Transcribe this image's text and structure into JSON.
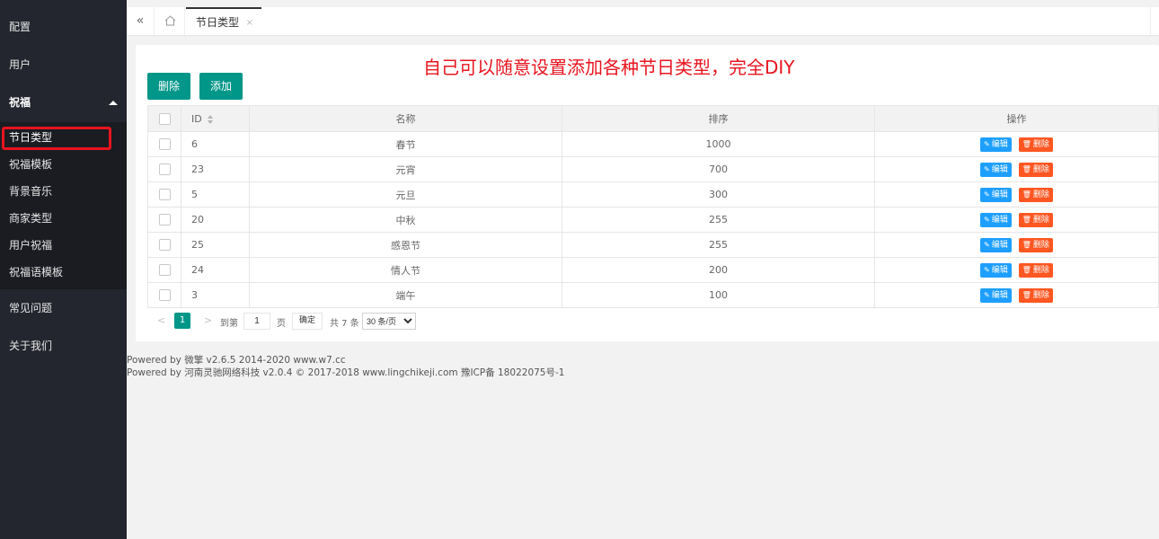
{
  "sidebar": {
    "items": [
      {
        "label": "配置"
      },
      {
        "label": "用户"
      },
      {
        "label": "祝福"
      },
      {
        "label": "常见问题"
      },
      {
        "label": "关于我们"
      }
    ],
    "subitems": [
      {
        "label": "节日类型"
      },
      {
        "label": "祝福模板"
      },
      {
        "label": "背景音乐"
      },
      {
        "label": "商家类型"
      },
      {
        "label": "用户祝福"
      },
      {
        "label": "祝福语模板"
      }
    ]
  },
  "tabs": {
    "collapse_icon": "«",
    "active_label": "节日类型",
    "close_icon": "×"
  },
  "annotation": "自己可以随意设置添加各种节日类型，完全DIY",
  "toolbar": {
    "delete_label": "删除",
    "add_label": "添加"
  },
  "table": {
    "headers": {
      "id": "ID",
      "name": "名称",
      "sort": "排序",
      "ops": "操作"
    },
    "edit_label": "编辑",
    "delete_label": "删除",
    "rows": [
      {
        "id": "6",
        "name": "春节",
        "sort": "1000"
      },
      {
        "id": "23",
        "name": "元宵",
        "sort": "700"
      },
      {
        "id": "5",
        "name": "元旦",
        "sort": "300"
      },
      {
        "id": "20",
        "name": "中秋",
        "sort": "255"
      },
      {
        "id": "25",
        "name": "感恩节",
        "sort": "255"
      },
      {
        "id": "24",
        "name": "情人节",
        "sort": "200"
      },
      {
        "id": "3",
        "name": "端午",
        "sort": "100"
      }
    ]
  },
  "pager": {
    "prev": "<",
    "current": "1",
    "next": ">",
    "goto_label": "到第",
    "page_value": "1",
    "page_unit": "页",
    "confirm": "确定",
    "total": "共 7 条",
    "page_size": "30 条/页"
  },
  "footer": {
    "line1": "Powered by 微擎 v2.6.5 2014-2020 www.w7.cc",
    "line2": "Powered by 河南灵驰网络科技 v2.0.4 © 2017-2018 www.lingchikeji.com 豫ICP备 18022075号-1"
  },
  "colors": {
    "sidebar_bg": "#23262e",
    "accent": "#009688",
    "edit": "#1e9fff",
    "delete": "#ff5722",
    "annotation": "#e8141e"
  }
}
